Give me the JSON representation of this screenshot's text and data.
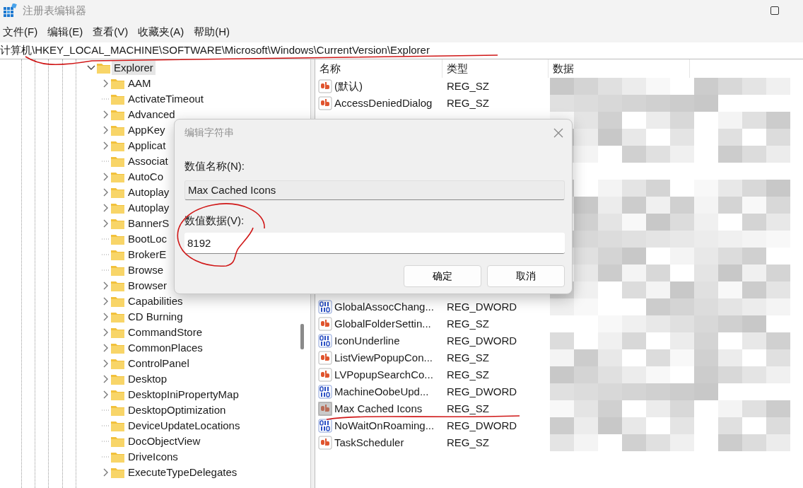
{
  "window": {
    "title": "注册表编辑器"
  },
  "menu": [
    "文件(F)",
    "编辑(E)",
    "查看(V)",
    "收藏夹(A)",
    "帮助(H)"
  ],
  "address": "计算机\\HKEY_LOCAL_MACHINE\\SOFTWARE\\Microsoft\\Windows\\CurrentVersion\\Explorer",
  "tree": {
    "items": [
      {
        "label": "Explorer",
        "selected": true,
        "expanded": true,
        "children": [
          {
            "label": "AAM",
            "selected": false,
            "has_children": true
          },
          {
            "label": "ActivateTimeout",
            "selected": false,
            "has_children": false
          },
          {
            "label": "Advanced",
            "selected": false,
            "has_children": true
          },
          {
            "label": "AppKey",
            "selected": false,
            "has_children": true
          },
          {
            "label": "Applicat",
            "selected": false,
            "has_children": true
          },
          {
            "label": "Associat",
            "selected": false,
            "has_children": false
          },
          {
            "label": "AutoCo",
            "selected": false,
            "has_children": true
          },
          {
            "label": "Autoplay",
            "selected": false,
            "has_children": true
          },
          {
            "label": "Autoplay",
            "selected": false,
            "has_children": true
          },
          {
            "label": "BannerS",
            "selected": false,
            "has_children": true
          },
          {
            "label": "BootLoc",
            "selected": false,
            "has_children": false
          },
          {
            "label": "BrokerE",
            "selected": false,
            "has_children": false
          },
          {
            "label": "Browse",
            "selected": false,
            "has_children": false
          },
          {
            "label": "Browser",
            "selected": false,
            "has_children": true
          },
          {
            "label": "Capabilities",
            "selected": false,
            "has_children": true
          },
          {
            "label": "CD Burning",
            "selected": false,
            "has_children": true
          },
          {
            "label": "CommandStore",
            "selected": false,
            "has_children": true
          },
          {
            "label": "CommonPlaces",
            "selected": false,
            "has_children": true
          },
          {
            "label": "ControlPanel",
            "selected": false,
            "has_children": true
          },
          {
            "label": "Desktop",
            "selected": false,
            "has_children": true
          },
          {
            "label": "DesktopIniPropertyMap",
            "selected": false,
            "has_children": true
          },
          {
            "label": "DesktopOptimization",
            "selected": false,
            "has_children": false
          },
          {
            "label": "DeviceUpdateLocations",
            "selected": false,
            "has_children": false
          },
          {
            "label": "DocObjectView",
            "selected": false,
            "has_children": false
          },
          {
            "label": "DriveIcons",
            "selected": false,
            "has_children": false
          },
          {
            "label": "ExecuteTypeDelegates",
            "selected": false,
            "has_children": true
          }
        ]
      }
    ]
  },
  "values": {
    "columns": [
      "名称",
      "类型",
      "数据"
    ],
    "groups": [
      [
        {
          "name": "(默认)",
          "type": "REG_SZ",
          "kind": "sz",
          "selected": false
        },
        {
          "name": "AccessDeniedDialog",
          "type": "REG_SZ",
          "kind": "sz",
          "selected": false
        }
      ],
      [
        {
          "name": "GlobalAssocChang...",
          "type": "REG_DWORD",
          "kind": "dword",
          "selected": false
        },
        {
          "name": "GlobalFolderSettin...",
          "type": "REG_SZ",
          "kind": "sz",
          "selected": false
        },
        {
          "name": "IconUnderline",
          "type": "REG_DWORD",
          "kind": "dword",
          "selected": false
        },
        {
          "name": "ListViewPopupCon...",
          "type": "REG_SZ",
          "kind": "sz",
          "selected": false
        },
        {
          "name": "LVPopupSearchCo...",
          "type": "REG_SZ",
          "kind": "sz",
          "selected": false
        },
        {
          "name": "MachineOobeUpd...",
          "type": "REG_DWORD",
          "kind": "dword",
          "selected": false
        },
        {
          "name": "Max Cached Icons",
          "type": "REG_SZ",
          "kind": "sz",
          "selected": true
        },
        {
          "name": "NoWaitOnRoaming...",
          "type": "REG_DWORD",
          "kind": "dword",
          "selected": false
        },
        {
          "name": "TaskScheduler",
          "type": "REG_SZ",
          "kind": "sz",
          "selected": false
        }
      ]
    ]
  },
  "dialog": {
    "title": "编辑字符串",
    "name_label": "数值名称(N):",
    "name_value": "Max Cached Icons",
    "data_label": "数值数据(V):",
    "data_value": "8192",
    "buttons": [
      "确定",
      "取消"
    ]
  }
}
